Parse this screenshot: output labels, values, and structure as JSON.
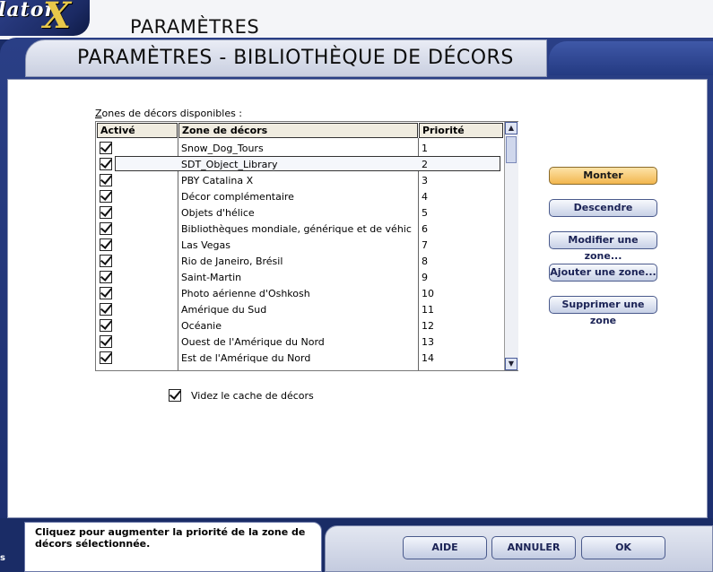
{
  "header": {
    "logo_text": "lator",
    "logo_x": "X",
    "title": "PARAMÈTRES"
  },
  "dialog": {
    "title": "PARAMÈTRES - BIBLIOTHÈQUE DE DÉCORS"
  },
  "list": {
    "label": "ones de décors disponibles :",
    "label_underlined": "Z",
    "columns": {
      "active": "Activé",
      "zone": "Zone de décors",
      "priority": "Priorité"
    },
    "rows": [
      {
        "zone": "Snow_Dog_Tours",
        "priority": "1",
        "active": true
      },
      {
        "zone": "SDT_Object_Library",
        "priority": "2",
        "active": true,
        "selected": true
      },
      {
        "zone": "PBY Catalina X",
        "priority": "3",
        "active": true
      },
      {
        "zone": "Décor complémentaire",
        "priority": "4",
        "active": true
      },
      {
        "zone": "Objets d'hélice",
        "priority": "5",
        "active": true
      },
      {
        "zone": "Bibliothèques mondiale, générique et de véhic",
        "priority": "6",
        "active": true
      },
      {
        "zone": "Las Vegas",
        "priority": "7",
        "active": true
      },
      {
        "zone": "Rio de Janeiro, Brésil",
        "priority": "8",
        "active": true
      },
      {
        "zone": "Saint-Martin",
        "priority": "9",
        "active": true
      },
      {
        "zone": "Photo aérienne d'Oshkosh",
        "priority": "10",
        "active": true
      },
      {
        "zone": "Amérique du Sud",
        "priority": "11",
        "active": true
      },
      {
        "zone": "Océanie",
        "priority": "12",
        "active": true
      },
      {
        "zone": "Ouest de l'Amérique du Nord",
        "priority": "13",
        "active": true
      },
      {
        "zone": "Est de l'Amérique du Nord",
        "priority": "14",
        "active": true
      }
    ]
  },
  "buttons": {
    "monter": "Monter",
    "descendre": "Descendre",
    "modifier": "Modifier une zone...",
    "ajouter": "Ajouter une zone...",
    "supprimer": "Supprimer une zone"
  },
  "cache": {
    "label": "Videz le cache de décors",
    "checked": true
  },
  "status": {
    "text": "Cliquez pour augmenter la priorité de la zone de décors sélectionnée.",
    "side_fragment": "s"
  },
  "footer": {
    "aide": "AIDE",
    "annuler": "ANNULER",
    "ok": "OK"
  },
  "colors": {
    "frame": "#1a2c66",
    "primary_button": "#f2b64f",
    "logo_accent": "#e8c84a"
  }
}
